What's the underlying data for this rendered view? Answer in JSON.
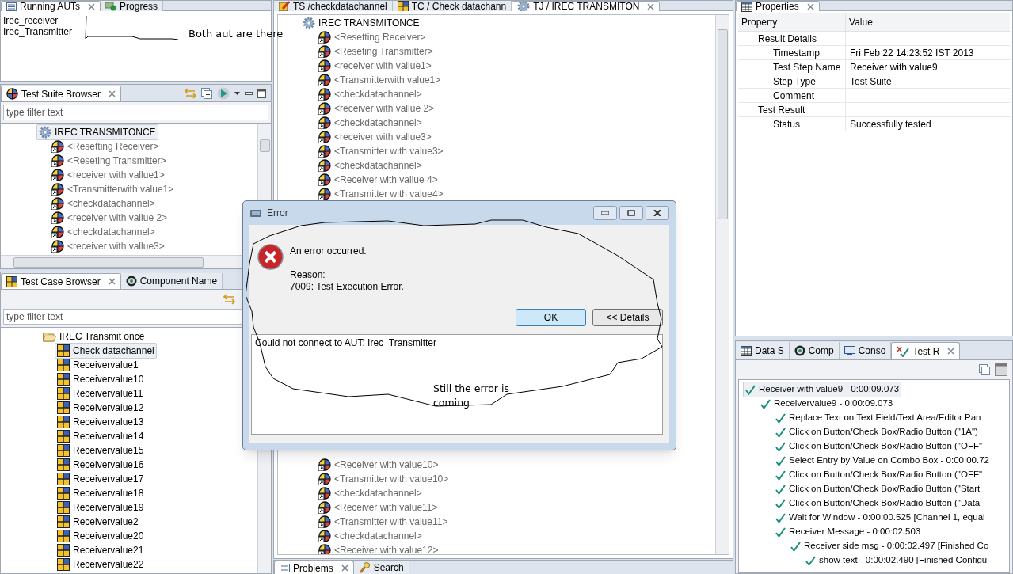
{
  "running_auts": {
    "tabs": [
      {
        "label": "Running AUTs",
        "selected": true
      },
      {
        "label": "Progress",
        "selected": false
      }
    ],
    "items": [
      "Irec_receiver",
      "Irec_Transmitter"
    ]
  },
  "test_suite_browser": {
    "tabs": [
      {
        "label": "Test Suite Browser",
        "selected": true
      }
    ],
    "filter_placeholder": "type filter text",
    "tree": {
      "label": "IREC TRANSMITONCE",
      "kind": "job",
      "selected": true,
      "children": [
        {
          "label": "<Resetting Receiver>",
          "kind": "ref",
          "selected": false
        },
        {
          "label": "<Reseting Transmitter>",
          "kind": "ref",
          "selected": false
        },
        {
          "label": "<receiver with vallue1>",
          "kind": "ref",
          "selected": false
        },
        {
          "label": "<Transmitterwith value1>",
          "kind": "ref",
          "selected": false
        },
        {
          "label": "<checkdatachannel>",
          "kind": "ref",
          "selected": false
        },
        {
          "label": "<receiver with vallue 2>",
          "kind": "ref",
          "selected": false
        },
        {
          "label": "<checkdatachannel>",
          "kind": "ref",
          "selected": false
        },
        {
          "label": "<receiver with vallue3>",
          "kind": "ref",
          "selected": false
        }
      ]
    }
  },
  "test_case_browser": {
    "tabs": [
      {
        "label": "Test Case Browser",
        "selected": true
      },
      {
        "label": "Component Name",
        "selected": false
      }
    ],
    "filter_placeholder": "type filter text",
    "tree": {
      "label": "IREC Transmit once",
      "kind": "folder",
      "selected": false,
      "children": [
        {
          "label": "Check datachannel",
          "kind": "testcase",
          "selected": true
        },
        {
          "label": "Receivervalue1",
          "kind": "testcase",
          "selected": false
        },
        {
          "label": "Receivervalue10",
          "kind": "testcase",
          "selected": false
        },
        {
          "label": "Receivervalue11",
          "kind": "testcase",
          "selected": false
        },
        {
          "label": "Receivervalue12",
          "kind": "testcase",
          "selected": false
        },
        {
          "label": "Receivervalue13",
          "kind": "testcase",
          "selected": false
        },
        {
          "label": "Receivervalue14",
          "kind": "testcase",
          "selected": false
        },
        {
          "label": "Receivervalue15",
          "kind": "testcase",
          "selected": false
        },
        {
          "label": "Receivervalue16",
          "kind": "testcase",
          "selected": false
        },
        {
          "label": "Receivervalue17",
          "kind": "testcase",
          "selected": false
        },
        {
          "label": "Receivervalue18",
          "kind": "testcase",
          "selected": false
        },
        {
          "label": "Receivervalue19",
          "kind": "testcase",
          "selected": false
        },
        {
          "label": "Receivervalue2",
          "kind": "testcase",
          "selected": false
        },
        {
          "label": "Receivervalue20",
          "kind": "testcase",
          "selected": false
        },
        {
          "label": "Receivervalue21",
          "kind": "testcase",
          "selected": false
        },
        {
          "label": "Receivervalue22",
          "kind": "testcase",
          "selected": false
        }
      ]
    }
  },
  "editor": {
    "tabs": [
      {
        "label": "TS /checkdatachannel",
        "selected": false
      },
      {
        "label": "TC / Check datachann",
        "selected": false
      },
      {
        "label": "TJ / IREC TRANSMITON",
        "selected": true
      }
    ],
    "tree": {
      "label": "IREC TRANSMITONCE",
      "kind": "job",
      "selected": false,
      "children": [
        {
          "label": "<Resetting Receiver>",
          "kind": "ref",
          "selected": false
        },
        {
          "label": "<Reseting Transmitter>",
          "kind": "ref",
          "selected": false
        },
        {
          "label": "<receiver with vallue1>",
          "kind": "ref",
          "selected": false
        },
        {
          "label": "<Transmitterwith value1>",
          "kind": "ref",
          "selected": false
        },
        {
          "label": "<checkdatachannel>",
          "kind": "ref",
          "selected": false
        },
        {
          "label": "<receiver with vallue 2>",
          "kind": "ref",
          "selected": false
        },
        {
          "label": "<checkdatachannel>",
          "kind": "ref",
          "selected": false
        },
        {
          "label": "<receiver with vallue3>",
          "kind": "ref",
          "selected": false
        },
        {
          "label": "<Transmitter with value3>",
          "kind": "ref",
          "selected": false
        },
        {
          "label": "<checkdatachannel>",
          "kind": "ref",
          "selected": false
        },
        {
          "label": "<Receiver with vallue 4>",
          "kind": "ref",
          "selected": false
        },
        {
          "label": "<Transmitter with  value4>",
          "kind": "ref",
          "selected": false
        }
      ]
    },
    "children_below_dialog": [
      {
        "label": "<Receiver with value10>",
        "kind": "ref",
        "selected": false
      },
      {
        "label": "<Transmitter with value10>",
        "kind": "ref",
        "selected": false
      },
      {
        "label": "<checkdatachannel>",
        "kind": "ref",
        "selected": false
      },
      {
        "label": "<Receiver with value11>",
        "kind": "ref",
        "selected": false
      },
      {
        "label": "<Transmitter with value11>",
        "kind": "ref",
        "selected": false
      },
      {
        "label": "<checkdatachannel>",
        "kind": "ref",
        "selected": false
      },
      {
        "label": "<Receiver with value12>",
        "kind": "ref",
        "selected": false
      }
    ]
  },
  "bottom_tabs": [
    {
      "label": "Problems",
      "selected": true
    },
    {
      "label": "Search",
      "selected": false
    }
  ],
  "properties": {
    "tabs": [
      {
        "label": "Properties",
        "selected": true
      }
    ],
    "columns": [
      "Property",
      "Value"
    ],
    "rows": [
      {
        "property": "Result Details",
        "children": [
          {
            "property": "Timestamp",
            "value": "Fri Feb 22 14:23:52 IST 2013"
          },
          {
            "property": "Test Step Name",
            "value": "Receiver with value9"
          },
          {
            "property": "Step Type",
            "value": "Test Suite"
          },
          {
            "property": "Comment"
          }
        ]
      },
      {
        "property": "Test Result",
        "children": [
          {
            "property": "Status",
            "value": "Successfully tested"
          }
        ]
      }
    ]
  },
  "test_results": {
    "tabs": [
      {
        "label": "Data S",
        "selected": false
      },
      {
        "label": "Comp",
        "selected": false
      },
      {
        "label": "Conso",
        "selected": false
      },
      {
        "label": "Test R",
        "selected": true
      }
    ],
    "tree": {
      "label": "Receiver with value9 - 0:00:09.073",
      "kind": "result",
      "selected": true,
      "children": [
        {
          "label": "Receivervalue9 - 0:00:09.073",
          "kind": "result",
          "selected": false,
          "children": [
            {
              "label": "Replace Text on Text Field/Text Area/Editor Pan",
              "kind": "result",
              "selected": false
            },
            {
              "label": "Click on Button/Check Box/Radio Button (\"1A\")",
              "kind": "result",
              "selected": false
            },
            {
              "label": "Click on Button/Check Box/Radio Button (\"OFF\"",
              "kind": "result",
              "selected": false
            },
            {
              "label": "Select Entry by Value on Combo Box - 0:00:00.72",
              "kind": "result",
              "selected": false
            },
            {
              "label": "Click on Button/Check Box/Radio Button (\"OFF\"",
              "kind": "result",
              "selected": false
            },
            {
              "label": "Click on Button/Check Box/Radio Button (\"Start",
              "kind": "result",
              "selected": false
            },
            {
              "label": "Click on Button/Check Box/Radio Button (\"Data",
              "kind": "result",
              "selected": false
            },
            {
              "label": "Wait for Window - 0:00:00.525 [Channel 1, equal",
              "kind": "result",
              "selected": false
            },
            {
              "label": "Receiver Message - 0:00:02.503",
              "kind": "result",
              "selected": false,
              "children": [
                {
                  "label": "Receiver side msg - 0:00:02.497 [Finished Co",
                  "kind": "result",
                  "selected": false,
                  "children": [
                    {
                      "label": "show text - 0:00:02.490 [Finished Configu",
                      "kind": "result",
                      "selected": false
                    }
                  ]
                }
              ]
            }
          ]
        }
      ]
    }
  },
  "dialog": {
    "title": "Error",
    "message": "An error occurred.",
    "reason_label": "Reason:",
    "reason": "7009: Test Execution Error.",
    "buttons": [
      {
        "label": "OK",
        "default": true
      },
      {
        "label": "<< Details",
        "default": false
      }
    ],
    "details": "Could not connect to AUT: Irec_Transmitter"
  },
  "annotations": [
    {
      "text": "Both aut are there"
    },
    {
      "text": "Still the error is coming"
    }
  ]
}
